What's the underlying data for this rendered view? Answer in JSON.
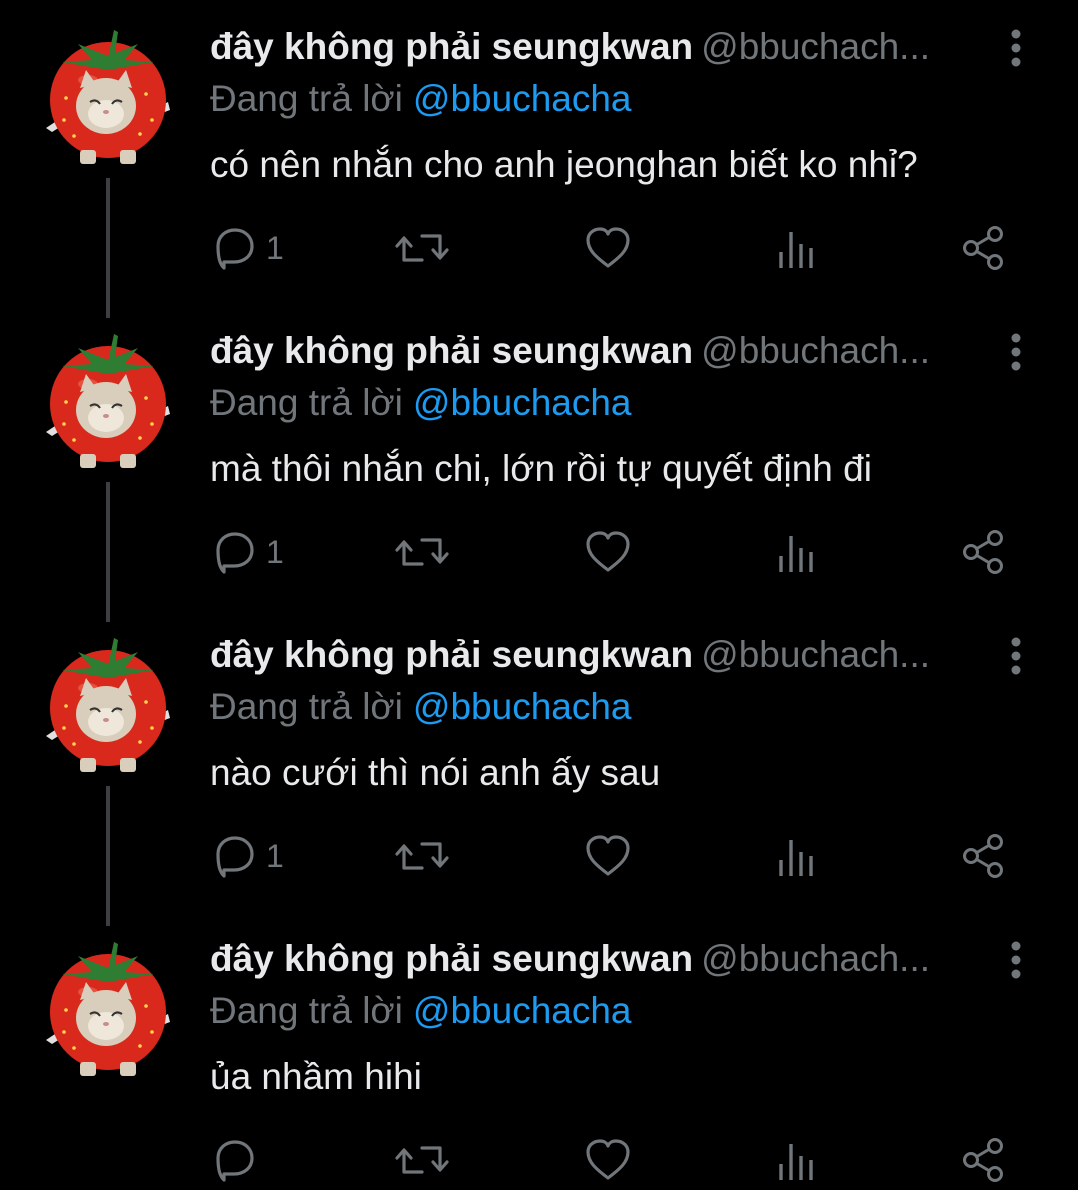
{
  "colors": {
    "background": "#000000",
    "text_primary": "#e7e9ea",
    "text_secondary": "#71767b",
    "accent_link": "#1d9bf0",
    "thread_line": "#3d3f43",
    "avatar_strawberry": "#d8291c"
  },
  "tweets": [
    {
      "display_name": "đây không phải seungkwan",
      "handle": "@bbuchach...",
      "replying_prefix": "Đang trả lời",
      "replying_handle": "@bbuchacha",
      "text": "có nên nhắn cho anh jeonghan biết ko nhỉ?",
      "reply_count": "1",
      "icons": [
        "reply-icon",
        "retweet-icon",
        "like-icon",
        "views-icon",
        "share-icon"
      ]
    },
    {
      "display_name": "đây không phải seungkwan",
      "handle": "@bbuchach...",
      "replying_prefix": "Đang trả lời",
      "replying_handle": "@bbuchacha",
      "text": "mà thôi nhắn chi, lớn rồi tự quyết định đi",
      "reply_count": "1",
      "icons": [
        "reply-icon",
        "retweet-icon",
        "like-icon",
        "views-icon",
        "share-icon"
      ]
    },
    {
      "display_name": "đây không phải seungkwan",
      "handle": "@bbuchach...",
      "replying_prefix": "Đang trả lời",
      "replying_handle": "@bbuchacha",
      "text": "nào cưới thì nói anh ấy sau",
      "reply_count": "1",
      "icons": [
        "reply-icon",
        "retweet-icon",
        "like-icon",
        "views-icon",
        "share-icon"
      ]
    },
    {
      "display_name": "đây không phải seungkwan",
      "handle": "@bbuchach...",
      "replying_prefix": "Đang trả lời",
      "replying_handle": "@bbuchacha",
      "text": "ủa nhầm hihi",
      "reply_count": "",
      "icons": [
        "reply-icon",
        "retweet-icon",
        "like-icon",
        "views-icon",
        "share-icon"
      ]
    }
  ]
}
